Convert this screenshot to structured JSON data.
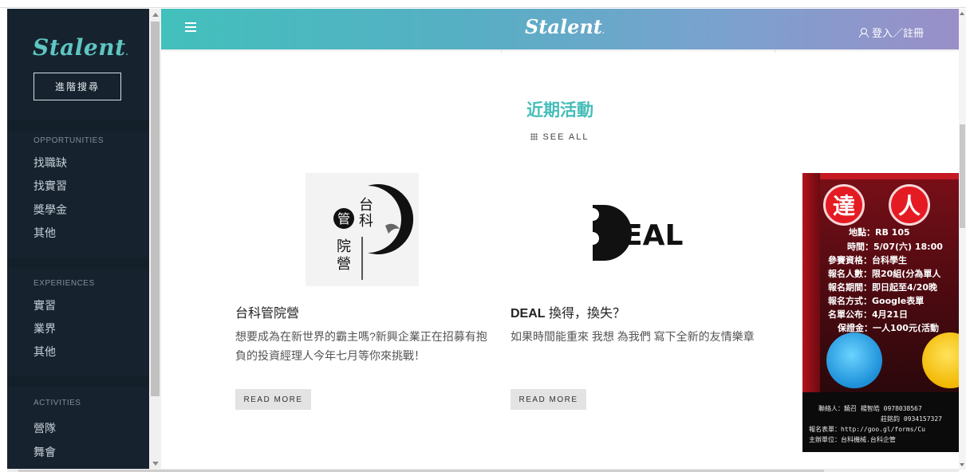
{
  "sidebar": {
    "logo": "Stalent",
    "advanced_search": "進階搜尋",
    "sections": [
      {
        "title": "OPPORTUNITIES",
        "items": [
          "找職缺",
          "找實習",
          "獎學金",
          "其他"
        ]
      },
      {
        "title": "EXPERIENCES",
        "items": [
          "實習",
          "業界",
          "其他"
        ]
      },
      {
        "title": "ACTIVITIES",
        "items": [
          "營隊",
          "舞會"
        ]
      }
    ]
  },
  "header": {
    "brand": "Stalent",
    "login": "登入／註冊"
  },
  "main": {
    "section_title": "近期活動",
    "see_all": "SEE ALL",
    "cards": [
      {
        "title": "台科管院營",
        "description": "想要成為在新世界的霸主嗎?新興企業正在招募有抱負的投資經理人今年七月等你來挑戰！",
        "read_more": "READ MORE",
        "image_text": {
          "top": "台",
          "middle": "科",
          "circle": "管",
          "b1": "院",
          "b2": "營"
        }
      },
      {
        "title_bold": "DEAL",
        "title_rest": " 換得，換失？",
        "description": "如果時間能重來 我想 為我們 寫下全新的友情樂章",
        "read_more": "READ MORE",
        "image_text": "EAL"
      },
      {
        "poster": {
          "badges": [
            "達",
            "人"
          ],
          "lines": [
            "地點：RB 105",
            "時間：5/07(六) 18:00",
            "參賽資格：台科學生",
            "報名人數：限20組(分為單人",
            "報名期間：即日起至4/20晚",
            "報名方式：Google表單",
            "名單公布：4月21日",
            "保證金：一人100元(活動"
          ],
          "footer": [
            "聯絡人：饒召 楊智皓 0978038567",
            "莊銘鈞 0934157327",
            "報名表單：http://goo.gl/forms/Cu",
            "主辦單位：台科機械.台科企管"
          ]
        }
      }
    ]
  }
}
